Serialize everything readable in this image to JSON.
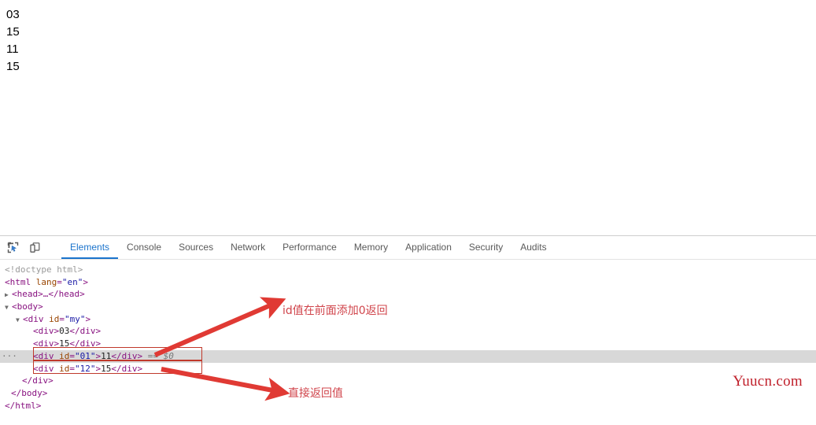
{
  "page": {
    "lines": [
      "03",
      "15",
      "11",
      "15"
    ]
  },
  "devtools": {
    "toolbar": {
      "inspect_icon": "inspect-element-icon",
      "device_icon": "device-toolbar-icon"
    },
    "tabs": [
      {
        "label": "Elements",
        "active": true
      },
      {
        "label": "Console",
        "active": false
      },
      {
        "label": "Sources",
        "active": false
      },
      {
        "label": "Network",
        "active": false
      },
      {
        "label": "Performance",
        "active": false
      },
      {
        "label": "Memory",
        "active": false
      },
      {
        "label": "Application",
        "active": false
      },
      {
        "label": "Security",
        "active": false
      },
      {
        "label": "Audits",
        "active": false
      }
    ],
    "dom": {
      "doctype": "<!doctype html>",
      "html_open_lt": "<",
      "html_tag": "html",
      "html_attr": " lang",
      "html_eq": "=",
      "html_val": "\"en\"",
      "html_gt": ">",
      "head_collapsed": "<head>…</head>",
      "body_open": "<body>",
      "div_my_open_lt": "<",
      "div_my_tag": "div",
      "div_my_attr": " id",
      "div_my_eq": "=",
      "div_my_val": "\"my\"",
      "div_my_gt": ">",
      "child1": {
        "open": "<div>",
        "text": "03",
        "close": "</div>"
      },
      "child2": {
        "open": "<div>",
        "text": "15",
        "close": "</div>"
      },
      "child3": {
        "open_lt": "<",
        "tag": "div",
        "attr": " id",
        "eq": "=",
        "val": "\"01\"",
        "gt": ">",
        "text": "11",
        "close": "</div>",
        "selected_marker": " == $0",
        "ellipsis": "···"
      },
      "child4": {
        "open_lt": "<",
        "tag": "div",
        "attr": " id",
        "eq": "=",
        "val": "\"12\"",
        "gt": ">",
        "text": "15",
        "close": "</div>"
      },
      "div_close": "</div>",
      "body_close": "</body>",
      "html_close": "</html>"
    }
  },
  "annotations": {
    "label_1": "id值在前面添加0返回",
    "label_2": "直接返回值",
    "color": "#d0444b",
    "arrow_color": "#e03a34"
  },
  "watermark": {
    "text": "Yuucn.com",
    "color": "#c0202b"
  }
}
